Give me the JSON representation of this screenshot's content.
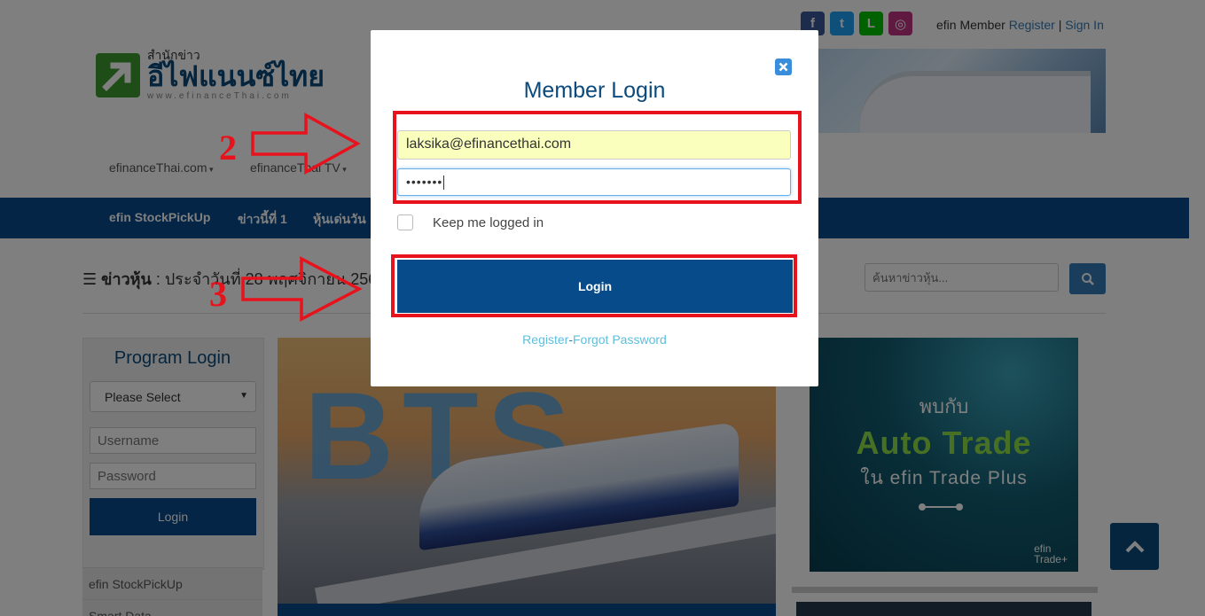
{
  "header": {
    "social": [
      {
        "icon": "facebook-icon",
        "glyph": "f",
        "color": "#3b5998"
      },
      {
        "icon": "twitter-icon",
        "glyph": "t",
        "color": "#1da1f2"
      },
      {
        "icon": "line-icon",
        "glyph": "L",
        "color": "#00c300"
      },
      {
        "icon": "instagram-icon",
        "glyph": "◎",
        "color": "#c13584"
      }
    ],
    "member_label": "efin Member",
    "register": "Register",
    "separator": "|",
    "sign_in": "Sign In"
  },
  "logo": {
    "small": "สำนักข่าว",
    "big": "อีไฟแนนซ์ไทย",
    "url": "www.efinanceThai.com"
  },
  "nav_dropdowns": [
    "efinanceThai.com",
    "efinanceThai TV"
  ],
  "navbar": [
    "efin StockPickUp",
    "ข่าวนี้ที่ 1",
    "หุ้นเด่นวัน"
  ],
  "news": {
    "label": "ข่าวหุ้น",
    "date": ": ประจำวันที่ 28 พฤศจิกายน 256"
  },
  "search": {
    "placeholder": "ค้นหาข่าวหุ้น..."
  },
  "program_login": {
    "title": "Program Login",
    "select": "Please Select",
    "username": "Username",
    "password": "Password",
    "button": "Login",
    "menu": [
      "efin StockPickUp",
      "Smart Data"
    ]
  },
  "banner_bts": {
    "letters": "BTS"
  },
  "auto_trade": {
    "line1": "พบกับ",
    "line2": "Auto Trade",
    "line3": "ใน efin Trade Plus",
    "brand1": "efin",
    "brand2": "Trade+"
  },
  "modal": {
    "title": "Member Login",
    "email": "laksika@efinancethai.com",
    "password_mask": "•••••••",
    "keep_logged_in": "Keep me logged in",
    "login_button": "Login",
    "register": "Register",
    "dash": "-",
    "forgot": "Forgot Password"
  },
  "annotations": {
    "step2": "2",
    "step3": "3"
  },
  "colors": {
    "brand_blue": "#084b8a",
    "link_blue": "#337ab7",
    "annotation_red": "#e8121c",
    "autofill": "#faffbd"
  }
}
